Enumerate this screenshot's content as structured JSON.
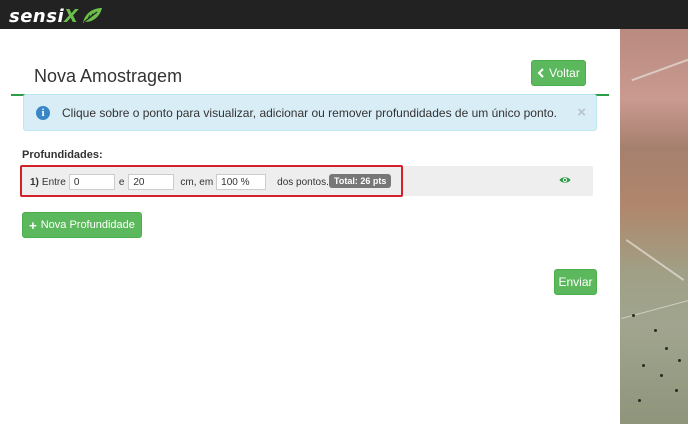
{
  "header": {
    "logo_main": "sensi",
    "logo_accent": "X",
    "background_color": "#222222",
    "accent_color": "#6cc04a"
  },
  "page": {
    "title": "Nova Amostragem",
    "back_button_label": "Voltar",
    "back_icon": "chevron-left-icon"
  },
  "alert": {
    "icon": "info-icon",
    "text": "Clique sobre o ponto para visualizar, adicionar ou remover profundidades de um único ponto.",
    "close_symbol": "×"
  },
  "depths": {
    "label": "Profundidades:",
    "rows": [
      {
        "number": "1)",
        "entre_label": "Entre",
        "from_value": "0",
        "e_label": "e",
        "to_value": "20",
        "unit_label": "cm, em",
        "percent_value": "100 %",
        "dos_pontos_label": "dos pontos.",
        "total_badge": "Total: 26 pts",
        "view_icon": "eye-icon"
      }
    ]
  },
  "actions": {
    "add_depth_label": "Nova Profundidade",
    "submit_label": "Enviar"
  },
  "colors": {
    "primary_button": "#5cb85c",
    "title_rule": "#2e9c46",
    "alert_background": "#d9edf7",
    "highlight_border": "#d22128"
  }
}
